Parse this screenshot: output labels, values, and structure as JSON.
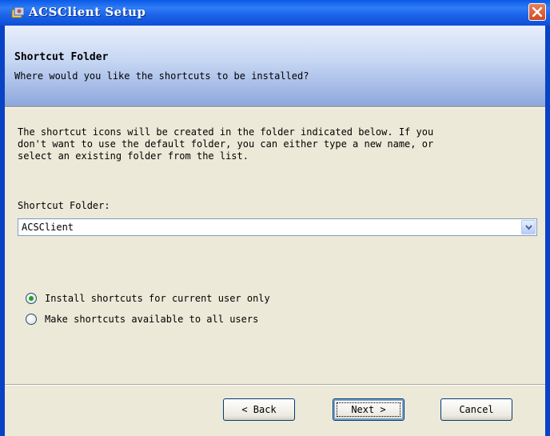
{
  "window": {
    "title": "ACSClient Setup"
  },
  "banner": {
    "title": "Shortcut Folder",
    "subtitle": "Where would you like the shortcuts to be installed?"
  },
  "description": "The shortcut icons will be created in the folder indicated below. If you\ndon't want to use the default folder, you can either type a new name, or\nselect an existing folder from the list.",
  "folder": {
    "label": "Shortcut Folder:",
    "value": "ACSClient"
  },
  "options": [
    {
      "label": "Install shortcuts for current user only",
      "selected": true
    },
    {
      "label": "Make shortcuts available to all users",
      "selected": false
    }
  ],
  "buttons": {
    "back": "< Back",
    "next": "Next >",
    "cancel": "Cancel"
  },
  "icons": {
    "title": "setup-app-icon",
    "close": "close-icon",
    "dropdown": "chevron-down-icon"
  },
  "colors": {
    "titlebar": "#0b4fd6",
    "dialog": "#ece9d8",
    "radio_dot": "#21a121"
  }
}
